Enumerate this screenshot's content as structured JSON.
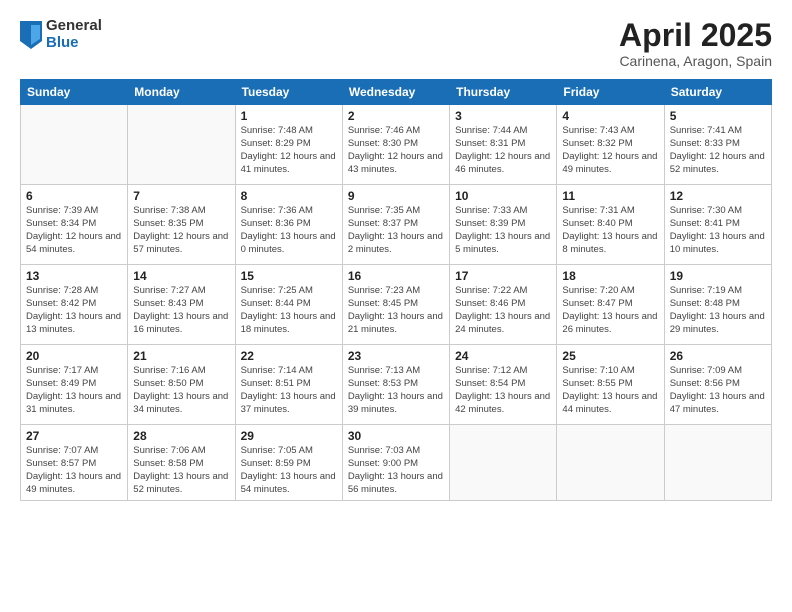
{
  "logo": {
    "general": "General",
    "blue": "Blue"
  },
  "title": "April 2025",
  "location": "Carinena, Aragon, Spain",
  "headers": [
    "Sunday",
    "Monday",
    "Tuesday",
    "Wednesday",
    "Thursday",
    "Friday",
    "Saturday"
  ],
  "weeks": [
    [
      {
        "num": "",
        "info": ""
      },
      {
        "num": "",
        "info": ""
      },
      {
        "num": "1",
        "info": "Sunrise: 7:48 AM\nSunset: 8:29 PM\nDaylight: 12 hours\nand 41 minutes."
      },
      {
        "num": "2",
        "info": "Sunrise: 7:46 AM\nSunset: 8:30 PM\nDaylight: 12 hours\nand 43 minutes."
      },
      {
        "num": "3",
        "info": "Sunrise: 7:44 AM\nSunset: 8:31 PM\nDaylight: 12 hours\nand 46 minutes."
      },
      {
        "num": "4",
        "info": "Sunrise: 7:43 AM\nSunset: 8:32 PM\nDaylight: 12 hours\nand 49 minutes."
      },
      {
        "num": "5",
        "info": "Sunrise: 7:41 AM\nSunset: 8:33 PM\nDaylight: 12 hours\nand 52 minutes."
      }
    ],
    [
      {
        "num": "6",
        "info": "Sunrise: 7:39 AM\nSunset: 8:34 PM\nDaylight: 12 hours\nand 54 minutes."
      },
      {
        "num": "7",
        "info": "Sunrise: 7:38 AM\nSunset: 8:35 PM\nDaylight: 12 hours\nand 57 minutes."
      },
      {
        "num": "8",
        "info": "Sunrise: 7:36 AM\nSunset: 8:36 PM\nDaylight: 13 hours\nand 0 minutes."
      },
      {
        "num": "9",
        "info": "Sunrise: 7:35 AM\nSunset: 8:37 PM\nDaylight: 13 hours\nand 2 minutes."
      },
      {
        "num": "10",
        "info": "Sunrise: 7:33 AM\nSunset: 8:39 PM\nDaylight: 13 hours\nand 5 minutes."
      },
      {
        "num": "11",
        "info": "Sunrise: 7:31 AM\nSunset: 8:40 PM\nDaylight: 13 hours\nand 8 minutes."
      },
      {
        "num": "12",
        "info": "Sunrise: 7:30 AM\nSunset: 8:41 PM\nDaylight: 13 hours\nand 10 minutes."
      }
    ],
    [
      {
        "num": "13",
        "info": "Sunrise: 7:28 AM\nSunset: 8:42 PM\nDaylight: 13 hours\nand 13 minutes."
      },
      {
        "num": "14",
        "info": "Sunrise: 7:27 AM\nSunset: 8:43 PM\nDaylight: 13 hours\nand 16 minutes."
      },
      {
        "num": "15",
        "info": "Sunrise: 7:25 AM\nSunset: 8:44 PM\nDaylight: 13 hours\nand 18 minutes."
      },
      {
        "num": "16",
        "info": "Sunrise: 7:23 AM\nSunset: 8:45 PM\nDaylight: 13 hours\nand 21 minutes."
      },
      {
        "num": "17",
        "info": "Sunrise: 7:22 AM\nSunset: 8:46 PM\nDaylight: 13 hours\nand 24 minutes."
      },
      {
        "num": "18",
        "info": "Sunrise: 7:20 AM\nSunset: 8:47 PM\nDaylight: 13 hours\nand 26 minutes."
      },
      {
        "num": "19",
        "info": "Sunrise: 7:19 AM\nSunset: 8:48 PM\nDaylight: 13 hours\nand 29 minutes."
      }
    ],
    [
      {
        "num": "20",
        "info": "Sunrise: 7:17 AM\nSunset: 8:49 PM\nDaylight: 13 hours\nand 31 minutes."
      },
      {
        "num": "21",
        "info": "Sunrise: 7:16 AM\nSunset: 8:50 PM\nDaylight: 13 hours\nand 34 minutes."
      },
      {
        "num": "22",
        "info": "Sunrise: 7:14 AM\nSunset: 8:51 PM\nDaylight: 13 hours\nand 37 minutes."
      },
      {
        "num": "23",
        "info": "Sunrise: 7:13 AM\nSunset: 8:53 PM\nDaylight: 13 hours\nand 39 minutes."
      },
      {
        "num": "24",
        "info": "Sunrise: 7:12 AM\nSunset: 8:54 PM\nDaylight: 13 hours\nand 42 minutes."
      },
      {
        "num": "25",
        "info": "Sunrise: 7:10 AM\nSunset: 8:55 PM\nDaylight: 13 hours\nand 44 minutes."
      },
      {
        "num": "26",
        "info": "Sunrise: 7:09 AM\nSunset: 8:56 PM\nDaylight: 13 hours\nand 47 minutes."
      }
    ],
    [
      {
        "num": "27",
        "info": "Sunrise: 7:07 AM\nSunset: 8:57 PM\nDaylight: 13 hours\nand 49 minutes."
      },
      {
        "num": "28",
        "info": "Sunrise: 7:06 AM\nSunset: 8:58 PM\nDaylight: 13 hours\nand 52 minutes."
      },
      {
        "num": "29",
        "info": "Sunrise: 7:05 AM\nSunset: 8:59 PM\nDaylight: 13 hours\nand 54 minutes."
      },
      {
        "num": "30",
        "info": "Sunrise: 7:03 AM\nSunset: 9:00 PM\nDaylight: 13 hours\nand 56 minutes."
      },
      {
        "num": "",
        "info": ""
      },
      {
        "num": "",
        "info": ""
      },
      {
        "num": "",
        "info": ""
      }
    ]
  ]
}
